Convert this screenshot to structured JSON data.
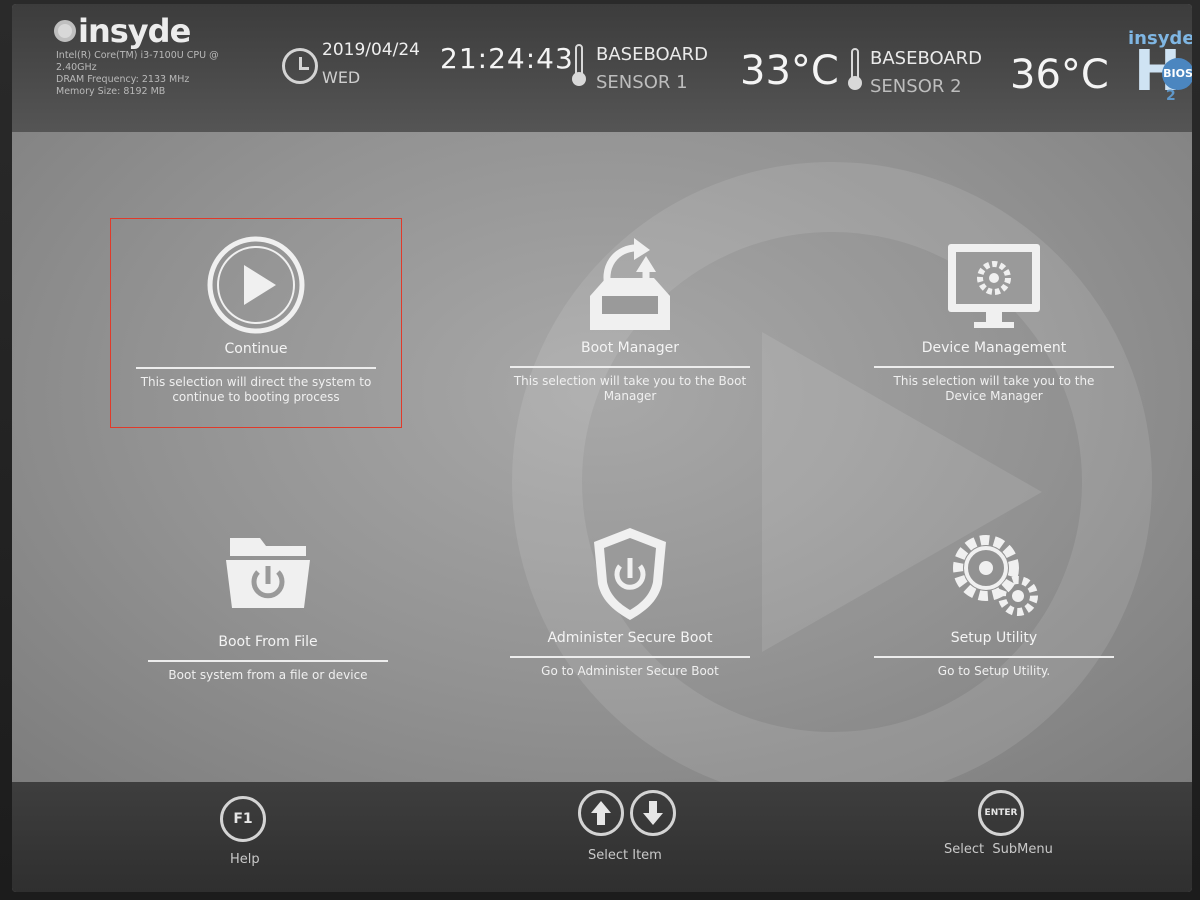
{
  "header": {
    "brand": "insyde",
    "sysinfo": [
      "Intel(R) Core(TM) i3-7100U CPU @",
      "2.40GHz",
      "DRAM Frequency: 2133 MHz",
      "Memory Size: 8192 MB"
    ],
    "date": "2019/04/24",
    "day": "WED",
    "time": "21:24:43",
    "sensor1": {
      "line1": "BASEBOARD",
      "line2": "SENSOR 1",
      "temp": "33°C"
    },
    "sensor2": {
      "line1": "BASEBOARD",
      "line2": "SENSOR 2",
      "temp": "36°C"
    },
    "h2_logo": {
      "top": "insyde",
      "h": "H",
      "sub": "2",
      "badge": "BIOS"
    }
  },
  "tiles": [
    {
      "key": "continue",
      "icon": "play-icon",
      "label": "Continue",
      "desc": "This selection will direct the system to continue to booting process",
      "selected": true
    },
    {
      "key": "boot-manager",
      "icon": "boot-manager-icon",
      "label": "Boot Manager",
      "desc": "This selection will take you to the Boot Manager",
      "selected": false
    },
    {
      "key": "device-management",
      "icon": "monitor-gear-icon",
      "label": "Device Management",
      "desc": "This selection will take you to the Device Manager",
      "selected": false
    },
    {
      "key": "boot-from-file",
      "icon": "folder-power-icon",
      "label": "Boot From File",
      "desc": "Boot system from a file or device",
      "selected": false
    },
    {
      "key": "administer-secure-boot",
      "icon": "shield-power-icon",
      "label": "Administer Secure Boot",
      "desc": "Go to Administer Secure Boot",
      "selected": false
    },
    {
      "key": "setup-utility",
      "icon": "gears-icon",
      "label": "Setup Utility",
      "desc": "Go to Setup Utility.",
      "selected": false
    }
  ],
  "footer": {
    "help": {
      "key": "F1",
      "label": "Help"
    },
    "select_item": {
      "label": "Select Item"
    },
    "select_submenu": {
      "key": "ENTER",
      "label": "Select  SubMenu"
    }
  },
  "colors": {
    "selection_border": "#e03a2a",
    "accent_blue": "#4b86c0"
  }
}
